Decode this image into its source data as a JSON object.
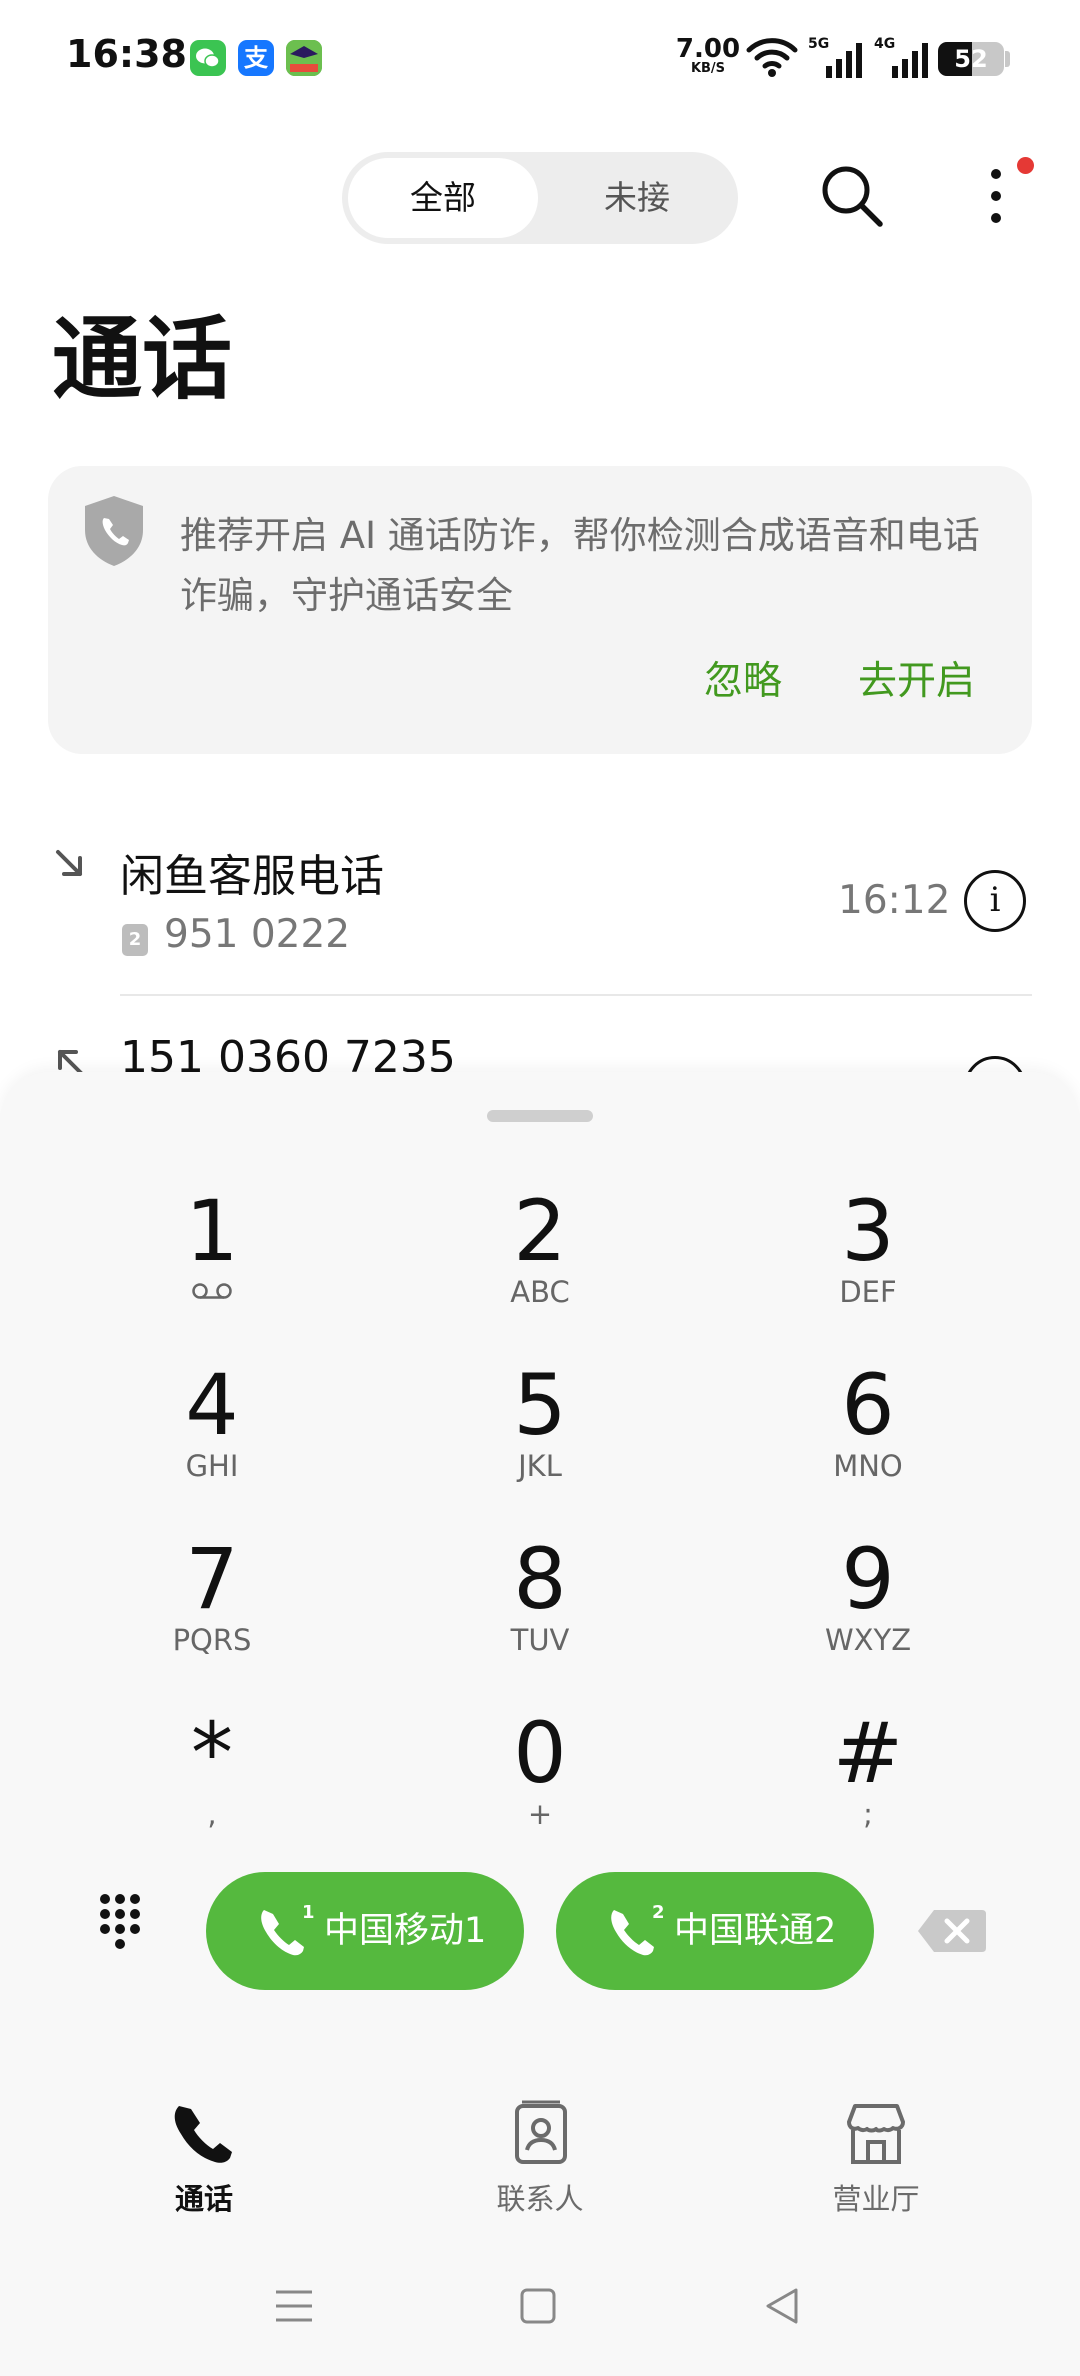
{
  "status_bar": {
    "time": "16:38",
    "apps": [
      "wechat-icon",
      "alipay-icon",
      "third-app-icon"
    ],
    "alipay_glyph": "支",
    "net_speed_value": "7.00",
    "net_speed_unit": "KB/S",
    "signal_1_label": "5G",
    "signal_2_label": "4G",
    "battery_level": "52",
    "battery_fraction": 0.52
  },
  "header": {
    "tabs": [
      {
        "label": "全部",
        "active": true
      },
      {
        "label": "未接",
        "active": false
      }
    ],
    "title": "通话"
  },
  "fraud_card": {
    "text": "推荐开启 AI 通话防诈，帮你检测合成语音和电话诈骗，守护通话安全",
    "ignore_label": "忽略",
    "enable_label": "去开启",
    "accent_color": "#42991f"
  },
  "call_log": [
    {
      "name": "闲鱼客服电话",
      "sim": "2",
      "number": "951 0222",
      "time": "16:12",
      "direction": "incoming"
    },
    {
      "name": "151 0360 7235",
      "direction": "outgoing"
    }
  ],
  "dialpad": {
    "keys": [
      {
        "digit": "1",
        "sub": ""
      },
      {
        "digit": "2",
        "sub": "ABC"
      },
      {
        "digit": "3",
        "sub": "DEF"
      },
      {
        "digit": "4",
        "sub": "GHI"
      },
      {
        "digit": "5",
        "sub": "JKL"
      },
      {
        "digit": "6",
        "sub": "MNO"
      },
      {
        "digit": "7",
        "sub": "PQRS"
      },
      {
        "digit": "8",
        "sub": "TUV"
      },
      {
        "digit": "9",
        "sub": "WXYZ"
      },
      {
        "digit": "*",
        "sub": ","
      },
      {
        "digit": "0",
        "sub": "+"
      },
      {
        "digit": "#",
        "sub": ";"
      }
    ],
    "call_buttons": [
      {
        "label": "中国移动1",
        "sim": "1"
      },
      {
        "label": "中国联通2",
        "sim": "2"
      }
    ],
    "call_color": "#55b93e"
  },
  "bottom_nav": [
    {
      "label": "通话",
      "active": true
    },
    {
      "label": "联系人",
      "active": false
    },
    {
      "label": "营业厅",
      "active": false
    }
  ]
}
